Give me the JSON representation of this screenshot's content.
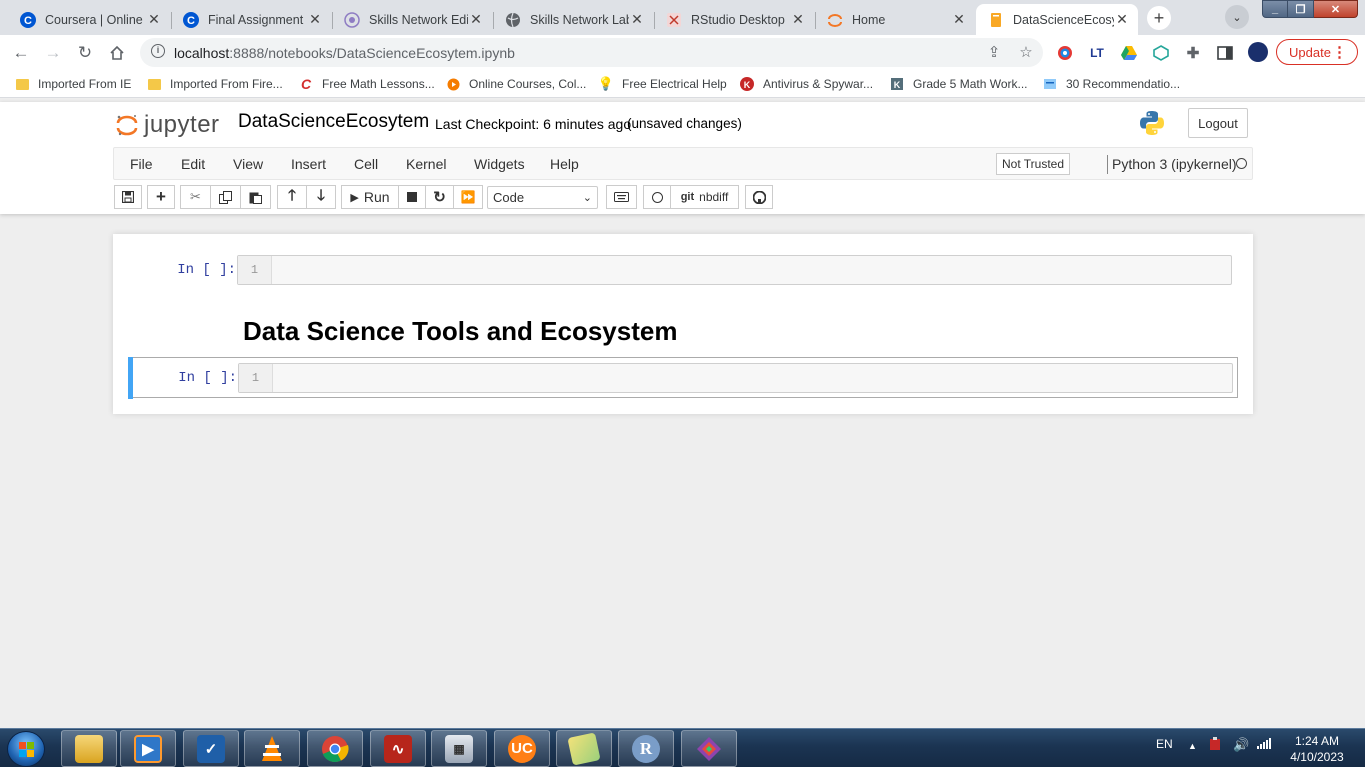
{
  "browser": {
    "tabs": [
      {
        "title": "Coursera | Online C",
        "favicon": "coursera-icon"
      },
      {
        "title": "Final Assignment I",
        "favicon": "coursera-icon"
      },
      {
        "title": "Skills Network Edit",
        "favicon": "skills-network-icon"
      },
      {
        "title": "Skills Network Lab",
        "favicon": "globe-icon"
      },
      {
        "title": "RStudio Desktop",
        "favicon": "rstudio-icon"
      },
      {
        "title": "Home",
        "favicon": "jupyter-icon"
      },
      {
        "title": "DataScienceEcosyt",
        "favicon": "notebook-icon",
        "active": true
      }
    ],
    "url_host": "localhost",
    "url_path": ":8888/notebooks/DataScienceEcosytem.ipynb",
    "update_label": "Update",
    "bookmarks": [
      {
        "label": "Imported From IE",
        "icon": "folder-icon"
      },
      {
        "label": "Imported From Fire...",
        "icon": "folder-icon"
      },
      {
        "label": "Free Math Lessons...",
        "icon": "math-lessons-icon"
      },
      {
        "label": "Online Courses, Col...",
        "icon": "online-courses-icon"
      },
      {
        "label": "Free Electrical Help",
        "icon": "lightbulb-icon"
      },
      {
        "label": "Antivirus & Spywar...",
        "icon": "antivirus-icon"
      },
      {
        "label": "Grade 5 Math Work...",
        "icon": "math-worksheet-icon"
      },
      {
        "label": "30 Recommendatio...",
        "icon": "recommendation-icon"
      }
    ]
  },
  "jupyter": {
    "logo_text": "jupyter",
    "notebook_name": "DataScienceEcosytem",
    "checkpoint": "Last Checkpoint: 6 minutes ago",
    "status": "(unsaved changes)",
    "logout_label": "Logout",
    "menu": [
      "File",
      "Edit",
      "View",
      "Insert",
      "Cell",
      "Kernel",
      "Widgets",
      "Help"
    ],
    "trust_label": "Not Trusted",
    "kernel_name": "Python 3 (ipykernel)",
    "toolbar": {
      "run_label": "Run",
      "cell_type": "Code",
      "git_label": "git",
      "nbdiff_label": "nbdiff"
    }
  },
  "notebook": {
    "cells": [
      {
        "type": "code",
        "prompt": "In [ ]:",
        "line_number": "1",
        "source": ""
      },
      {
        "type": "markdown",
        "heading": "Data Science Tools and Ecosystem"
      },
      {
        "type": "code",
        "prompt": "In [ ]:",
        "line_number": "1",
        "source": "",
        "selected": true
      }
    ]
  },
  "taskbar": {
    "language": "EN",
    "time": "1:24 AM",
    "date": "4/10/2023",
    "apps": [
      "file-explorer-icon",
      "media-player-icon",
      "onedrive-icon",
      "vlc-icon",
      "chrome-icon",
      "pdf-reader-icon",
      "calculator-icon",
      "uc-browser-icon",
      "photos-icon",
      "r-icon",
      "git-gui-icon"
    ]
  },
  "colors": {
    "accent_blue": "#42a5f5",
    "prompt_blue": "#303f9f",
    "update_red": "#d93025",
    "jupyter_orange": "#f37726"
  }
}
